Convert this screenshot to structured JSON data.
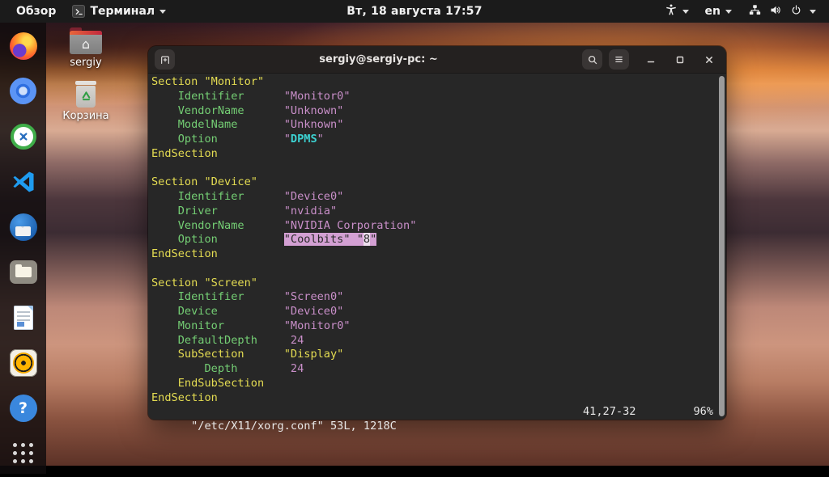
{
  "topbar": {
    "activities": "Обзор",
    "app_menu": {
      "label": "Терминал",
      "icon": "terminal-app-icon"
    },
    "clock": "Вт, 18 августа 17:57",
    "input_language": "en",
    "tray_icons": [
      "accessibility-icon",
      "network-wired-icon",
      "volume-icon",
      "power-icon"
    ]
  },
  "desktop": {
    "icons": [
      {
        "label": "sergiy",
        "icon": "home-folder-icon"
      },
      {
        "label": "Корзина",
        "icon": "trash-icon"
      }
    ]
  },
  "dock": {
    "items": [
      "firefox-icon",
      "chromium-icon",
      "sync-circle-icon",
      "vscode-icon",
      "thunderbird-icon",
      "files-icon",
      "libreoffice-writer-icon",
      "rhythmbox-icon",
      "help-icon",
      "app-grid-icon"
    ],
    "help_glyph": "?"
  },
  "terminal": {
    "title": "sergiy@sergiy-pc: ~",
    "header_icons": [
      "new-tab-icon",
      "search-icon",
      "menu-icon",
      "minimize-icon",
      "maximize-icon",
      "close-icon"
    ],
    "colors": {
      "kw": "#e4dc52",
      "id": "#74ce74",
      "str": "#c98fc9",
      "num": "#c98fc9",
      "sp": "#3cd2d2",
      "plain": "#e8e8e8",
      "selBg": "#d3a0d3",
      "selFg": "#2a2a2a",
      "curBg": "#eedfee",
      "curFg": "#2a2a2a"
    },
    "lines": [
      [
        [
          "Section \"Monitor\"",
          "kw"
        ]
      ],
      [
        [
          "    ",
          "pl"
        ],
        [
          "Identifier",
          "id"
        ],
        [
          "      ",
          "pl"
        ],
        [
          "\"Monitor0\"",
          "str"
        ]
      ],
      [
        [
          "    ",
          "pl"
        ],
        [
          "VendorName",
          "id"
        ],
        [
          "      ",
          "pl"
        ],
        [
          "\"Unknown\"",
          "str"
        ]
      ],
      [
        [
          "    ",
          "pl"
        ],
        [
          "ModelName",
          "id"
        ],
        [
          "       ",
          "pl"
        ],
        [
          "\"Unknown\"",
          "str"
        ]
      ],
      [
        [
          "    ",
          "pl"
        ],
        [
          "Option",
          "id"
        ],
        [
          "          ",
          "pl"
        ],
        [
          "\"",
          "str"
        ],
        [
          "DPMS",
          "sp"
        ],
        [
          "\"",
          "str"
        ]
      ],
      [
        [
          "EndSection",
          "kw"
        ]
      ],
      [],
      [
        [
          "Section \"Device\"",
          "kw"
        ]
      ],
      [
        [
          "    ",
          "pl"
        ],
        [
          "Identifier",
          "id"
        ],
        [
          "      ",
          "pl"
        ],
        [
          "\"Device0\"",
          "str"
        ]
      ],
      [
        [
          "    ",
          "pl"
        ],
        [
          "Driver",
          "id"
        ],
        [
          "          ",
          "pl"
        ],
        [
          "\"nvidia\"",
          "str"
        ]
      ],
      [
        [
          "    ",
          "pl"
        ],
        [
          "VendorName",
          "id"
        ],
        [
          "      ",
          "pl"
        ],
        [
          "\"NVIDIA Corporation\"",
          "str"
        ]
      ],
      [
        [
          "    ",
          "pl"
        ],
        [
          "Option",
          "id"
        ],
        [
          "          ",
          "pl"
        ],
        [
          "\"Coolbits\" \"",
          "sel"
        ],
        [
          "8",
          "cur"
        ],
        [
          "\"",
          "sel"
        ]
      ],
      [
        [
          "EndSection",
          "kw"
        ]
      ],
      [],
      [
        [
          "Section \"Screen\"",
          "kw"
        ]
      ],
      [
        [
          "    ",
          "pl"
        ],
        [
          "Identifier",
          "id"
        ],
        [
          "      ",
          "pl"
        ],
        [
          "\"Screen0\"",
          "str"
        ]
      ],
      [
        [
          "    ",
          "pl"
        ],
        [
          "Device",
          "id"
        ],
        [
          "          ",
          "pl"
        ],
        [
          "\"Device0\"",
          "str"
        ]
      ],
      [
        [
          "    ",
          "pl"
        ],
        [
          "Monitor",
          "id"
        ],
        [
          "         ",
          "pl"
        ],
        [
          "\"Monitor0\"",
          "str"
        ]
      ],
      [
        [
          "    ",
          "pl"
        ],
        [
          "DefaultDepth",
          "id"
        ],
        [
          "     ",
          "pl"
        ],
        [
          "24",
          "num"
        ]
      ],
      [
        [
          "    ",
          "pl"
        ],
        [
          "SubSection",
          "kw"
        ],
        [
          "      ",
          "pl"
        ],
        [
          "\"Display\"",
          "kw"
        ]
      ],
      [
        [
          "        ",
          "pl"
        ],
        [
          "Depth",
          "id"
        ],
        [
          "        ",
          "pl"
        ],
        [
          "24",
          "num"
        ]
      ],
      [
        [
          "    ",
          "pl"
        ],
        [
          "EndSubSection",
          "kw"
        ]
      ],
      [
        [
          "EndSection",
          "kw"
        ]
      ]
    ],
    "status": {
      "file_info": "\"/etc/X11/xorg.conf\" 53L, 1218C",
      "ruler": "41,27-32",
      "percent": "96%"
    }
  }
}
